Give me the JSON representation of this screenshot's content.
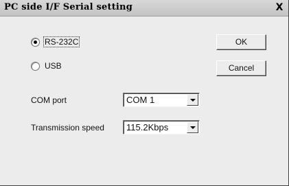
{
  "dialog": {
    "title": "PC side I/F  Serial setting",
    "close_label": "X"
  },
  "interface": {
    "options": [
      {
        "label": "RS-232C",
        "checked": true
      },
      {
        "label": "USB",
        "checked": false
      }
    ]
  },
  "buttons": {
    "ok_label": "OK",
    "cancel_label": "Cancel"
  },
  "com_port": {
    "label": "COM port",
    "value": "COM 1"
  },
  "transmission_speed": {
    "label": "Transmission speed",
    "value": "115.2Kbps"
  },
  "icons": {
    "close": "close-icon",
    "dropdown": "chevron-down-icon"
  }
}
